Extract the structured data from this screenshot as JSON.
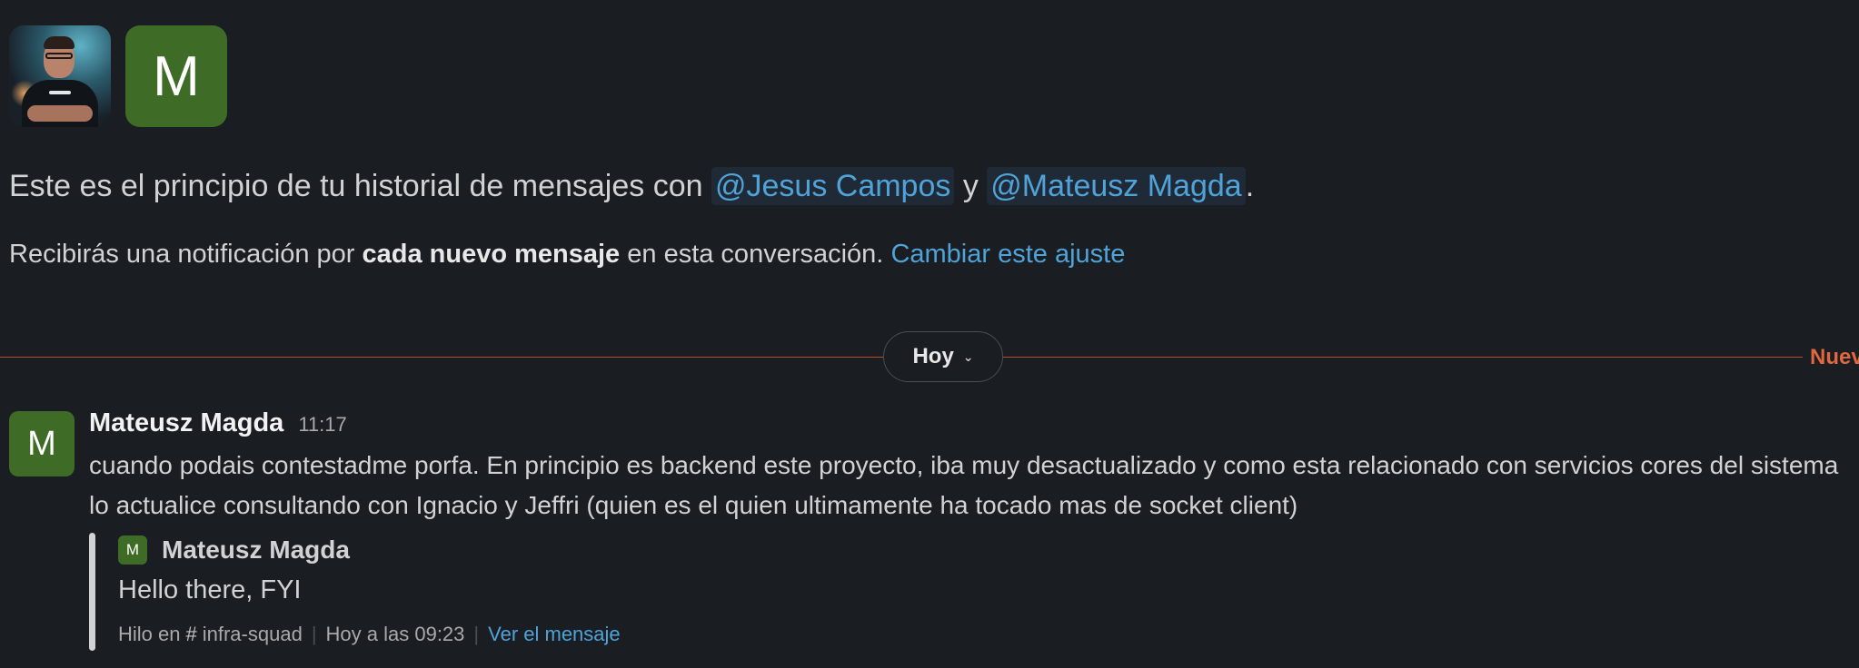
{
  "header": {
    "avatar_letter": "M"
  },
  "intro": {
    "prefix": "Este es el principio de tu historial de mensajes con",
    "mention1": "@Jesus Campos",
    "connector": "y",
    "mention2": "@Mateusz Magda",
    "suffix": "."
  },
  "notification": {
    "prefix": "Recibirás una notificación por",
    "bold": "cada nuevo mensaje",
    "middle": "en esta conversación.",
    "link": "Cambiar este ajuste"
  },
  "divider": {
    "day_label": "Hoy",
    "new_label": "Nuev"
  },
  "message": {
    "avatar_letter": "M",
    "sender": "Mateusz Magda",
    "time": "11:17",
    "text": "cuando podais contestadme porfa. En principio es backend este proyecto, iba muy desactualizado y como esta relacionado con servicios cores del sistema lo actualice consultando con Ignacio y Jeffri (quien es el quien ultimamente ha tocado mas de socket client)",
    "quote": {
      "avatar_letter": "M",
      "sender": "Mateusz Magda",
      "text": "Hello there, FYI",
      "thread_prefix": "Hilo en",
      "channel_icon": "#",
      "channel": "infra-squad",
      "timestamp": "Hoy a las 09:23",
      "view_link": "Ver el mensaje"
    }
  }
}
